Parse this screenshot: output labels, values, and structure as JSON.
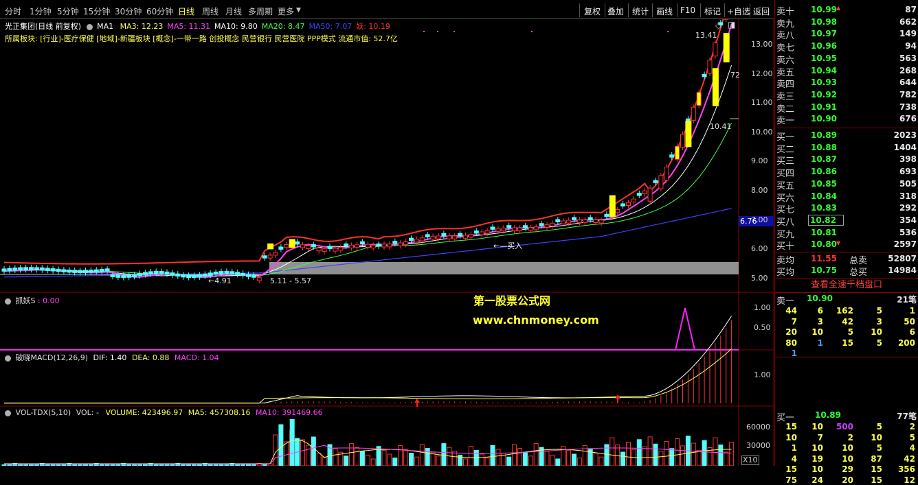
{
  "toolbar": {
    "periods": [
      "分时",
      "1分钟",
      "5分钟",
      "15分钟",
      "30分钟",
      "60分钟",
      "日线",
      "周线",
      "月线",
      "多周期",
      "更多"
    ],
    "active_period": "日线",
    "right_buttons": [
      "复权",
      "叠加",
      "统计",
      "画线",
      "F10",
      "标记",
      "+自选",
      "返回"
    ]
  },
  "main_chart": {
    "stock_title": "光正集团(日线 前复权)",
    "ma_label": "MA1",
    "ma_values": [
      {
        "text": "MA3: 12.23",
        "color": "#ffff50"
      },
      {
        "text": "MA5: 11.31",
        "color": "#ff40ff"
      },
      {
        "text": "MA10: 9.80",
        "color": "#ffffff"
      },
      {
        "text": "MA20: 8.47",
        "color": "#40ff40"
      },
      {
        "text": "MA50: 7.07",
        "color": "#4040ff"
      },
      {
        "text": "妖: 10.19",
        "color": "#ff3030"
      }
    ],
    "sector_line": "所属板块: [行业]-医疗保健 [地域]-新疆板块 [概念]-一带一路 创投概念 民营银行 民营医院 PPP模式 流通市值: 52.7亿",
    "y_ticks": [
      "13.00",
      "12.00",
      "11.00",
      "10.00",
      "9.00",
      "8.00",
      "7.00",
      "6.00",
      "5.00"
    ],
    "price_tag": "6.76",
    "annotations": {
      "high": "13.41",
      "mid": "10.41",
      "low": "4.91",
      "range": "5.11 - 5.57",
      "buy": "买入",
      "seven_two": "72"
    }
  },
  "watermark": {
    "line1": "第一股票公式网",
    "line2": "www.chnmoney.com"
  },
  "indicator1": {
    "title": "抓妖S",
    "value": ": 0.00",
    "y_ticks": [
      "1.00",
      "0.50"
    ]
  },
  "indicator2": {
    "title": "破晓MACD(12,26,9)",
    "dif": "DIF: 1.40",
    "dea": "DEA: 0.88",
    "macd": "MACD: 1.04",
    "y_ticks": [
      "1.00"
    ]
  },
  "indicator3": {
    "title": "VOL-TDX(5,10)",
    "vol": "VOL: -",
    "volume": "VOLUME: 423496.97",
    "ma5": "MA5: 457308.16",
    "ma10": "MA10: 391469.66",
    "y_ticks": [
      "60000",
      "30000"
    ],
    "unit": "X10"
  },
  "order_book": {
    "asks": [
      {
        "label": "卖十",
        "price": "10.99",
        "vol": "87",
        "up": true
      },
      {
        "label": "卖九",
        "price": "10.98",
        "vol": "662"
      },
      {
        "label": "卖八",
        "price": "10.97",
        "vol": "149"
      },
      {
        "label": "卖七",
        "price": "10.96",
        "vol": "94"
      },
      {
        "label": "卖六",
        "price": "10.95",
        "vol": "563"
      },
      {
        "label": "卖五",
        "price": "10.94",
        "vol": "268"
      },
      {
        "label": "卖四",
        "price": "10.93",
        "vol": "644"
      },
      {
        "label": "卖三",
        "price": "10.92",
        "vol": "782"
      },
      {
        "label": "卖二",
        "price": "10.91",
        "vol": "738"
      },
      {
        "label": "卖一",
        "price": "10.90",
        "vol": "676"
      }
    ],
    "bids": [
      {
        "label": "买一",
        "price": "10.89",
        "vol": "2023"
      },
      {
        "label": "买二",
        "price": "10.88",
        "vol": "1404"
      },
      {
        "label": "买三",
        "price": "10.87",
        "vol": "398"
      },
      {
        "label": "买四",
        "price": "10.86",
        "vol": "693"
      },
      {
        "label": "买五",
        "price": "10.85",
        "vol": "505"
      },
      {
        "label": "买六",
        "price": "10.84",
        "vol": "318"
      },
      {
        "label": "买七",
        "price": "10.83",
        "vol": "292"
      },
      {
        "label": "买八",
        "price": "10.82",
        "vol": "354"
      },
      {
        "label": "买九",
        "price": "10.81",
        "vol": "536"
      },
      {
        "label": "买十",
        "price": "10.80",
        "vol": "2597",
        "down": true
      }
    ],
    "ask_avg_label": "卖均",
    "ask_avg": "11.55",
    "total_sell_label": "总卖",
    "total_sell": "52807",
    "bid_avg_label": "买均",
    "bid_avg": "10.75",
    "total_buy_label": "总买",
    "total_buy": "14984",
    "full_depth_button": "查看全速千档盘口",
    "queue_sell": {
      "label": "卖一",
      "price": "10.90",
      "count": "21笔",
      "rows": [
        [
          "44",
          "6",
          "162",
          "5",
          "1"
        ],
        [
          "7",
          "3",
          "42",
          "3",
          "50"
        ],
        [
          "20",
          "10",
          "5",
          "10",
          "6"
        ],
        [
          "80",
          "1",
          "15",
          "5",
          "200"
        ],
        [
          "1",
          "",
          "",
          "",
          ""
        ]
      ]
    },
    "queue_buy": {
      "label": "买一",
      "price": "10.89",
      "count": "77笔",
      "rows": [
        [
          "15",
          "10",
          "500",
          "5",
          "2"
        ],
        [
          "10",
          "7",
          "2",
          "10",
          "5"
        ],
        [
          "1",
          "10",
          "10",
          "5",
          "4"
        ],
        [
          "4",
          "19",
          "10",
          "87",
          "42"
        ],
        [
          "15",
          "10",
          "29",
          "15",
          "356"
        ],
        [
          "75",
          "24",
          "20",
          "15",
          "12"
        ]
      ]
    }
  },
  "colors": {
    "up": "#ff3232",
    "down": "#54fcfc",
    "ma3": "#ffff50",
    "ma5": "#ff40ff",
    "ma10": "#ffffff",
    "ma20": "#40ff40",
    "ma50": "#4040ff",
    "yao": "#ff3030",
    "grid": "#8b0000"
  }
}
